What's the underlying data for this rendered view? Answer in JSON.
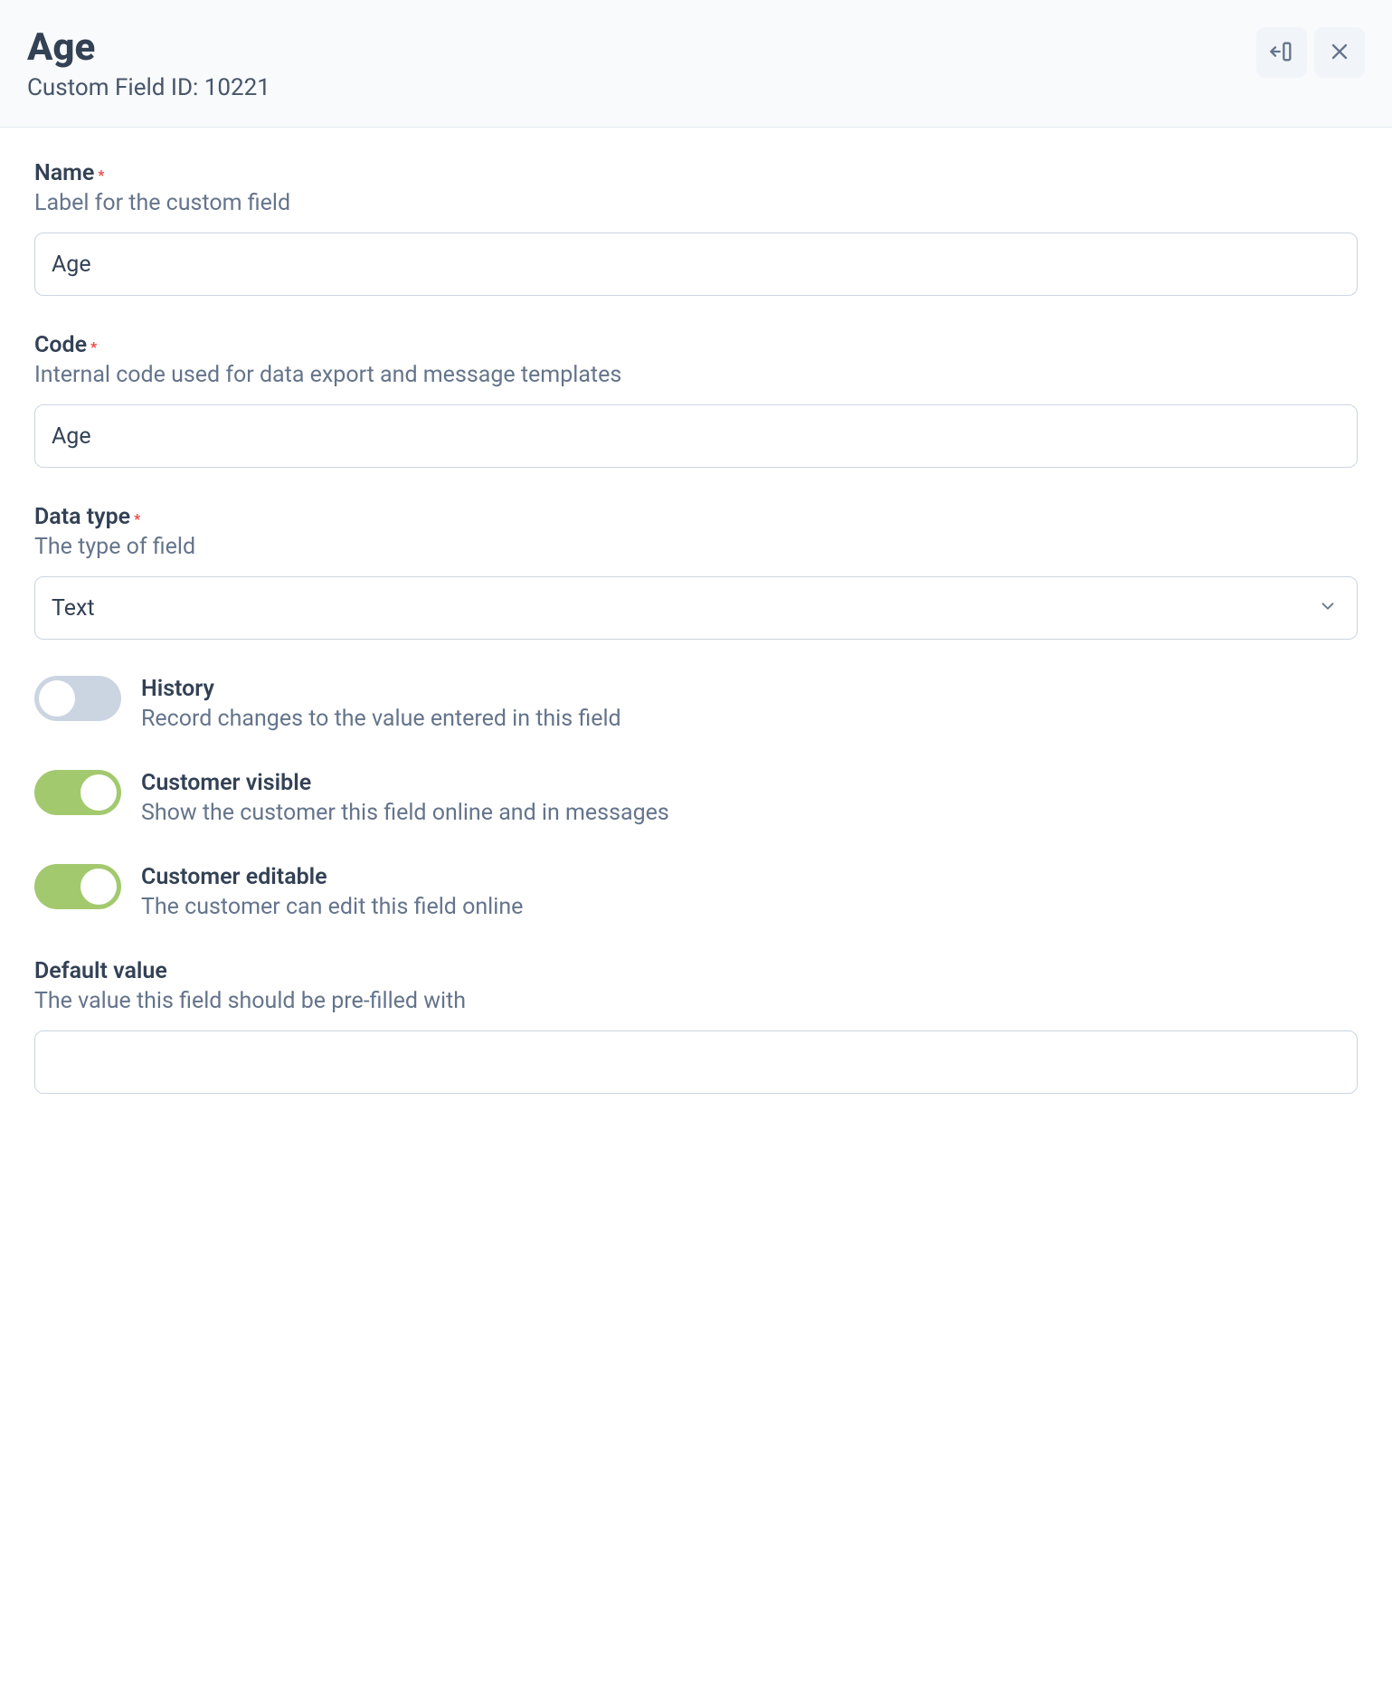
{
  "header": {
    "title": "Age",
    "subtitle": "Custom Field ID: 10221"
  },
  "fields": {
    "name": {
      "label": "Name",
      "required": "*",
      "hint": "Label for the custom field",
      "value": "Age"
    },
    "code": {
      "label": "Code",
      "required": "*",
      "hint": "Internal code used for data export and message templates",
      "value": "Age"
    },
    "dataType": {
      "label": "Data type",
      "required": "*",
      "hint": "The type of field",
      "value": "Text"
    },
    "history": {
      "label": "History",
      "hint": "Record changes to the value entered in this field",
      "on": false
    },
    "customerVisible": {
      "label": "Customer visible",
      "hint": "Show the customer this field online and in messages",
      "on": true
    },
    "customerEditable": {
      "label": "Customer editable",
      "hint": "The customer can edit this field online",
      "on": true
    },
    "defaultValue": {
      "label": "Default value",
      "hint": "The value this field should be pre-filled with",
      "value": ""
    }
  }
}
